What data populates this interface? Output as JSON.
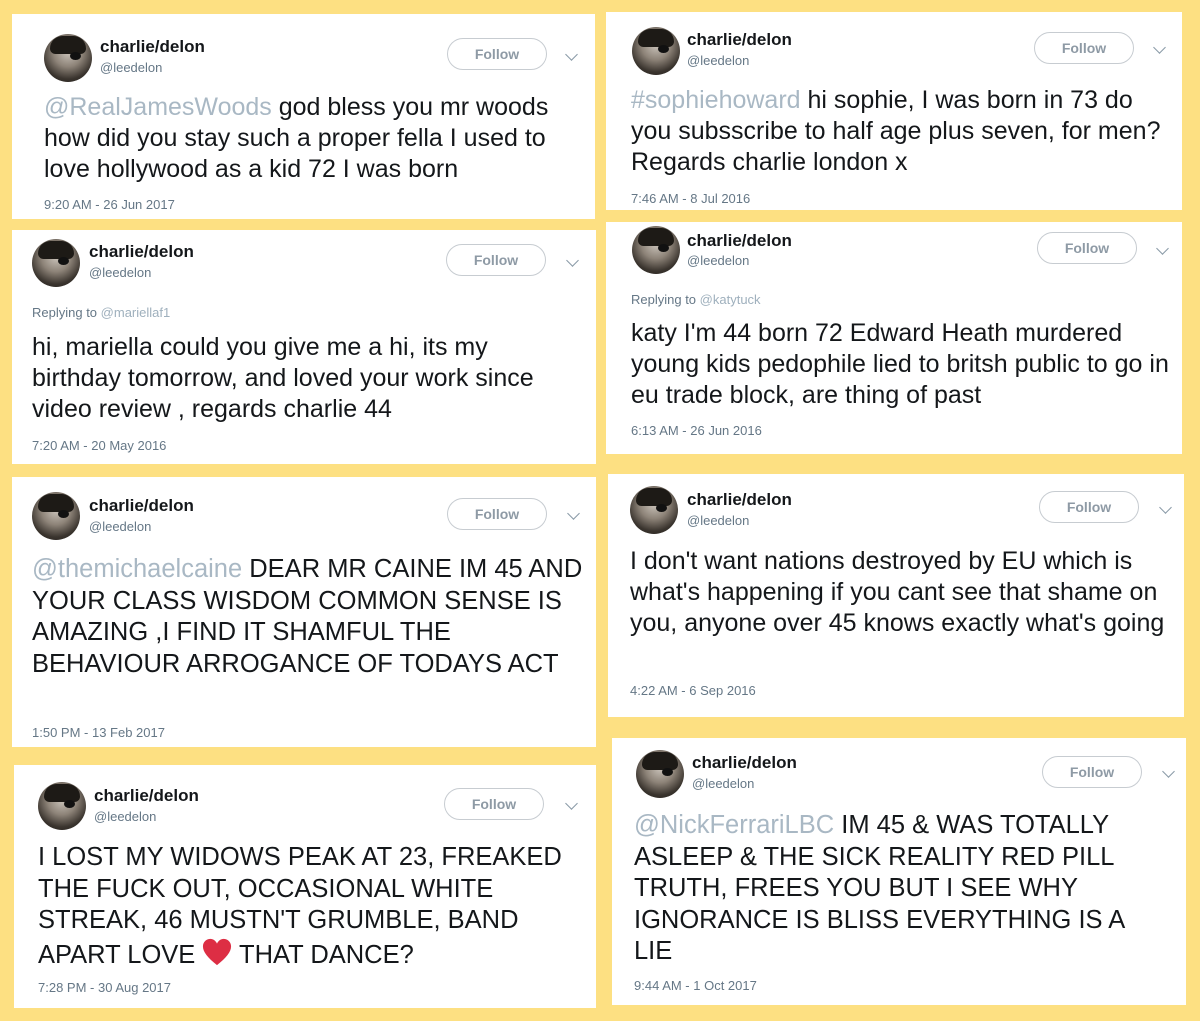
{
  "user": {
    "name": "charlie/delon",
    "handle": "@leedelon",
    "follow_label": "Follow"
  },
  "tweets": [
    {
      "mention": "@RealJamesWoods",
      "text": " god bless you mr woods how did you stay such a proper fella I used to love hollywood as a kid 72 I was born",
      "time": "9:20 AM - 26 Jun 2017"
    },
    {
      "mention": "#sophiehoward",
      "text": "  hi sophie, I was born in 73 do you subsscribe to half age plus seven, for men?  Regards charlie london x",
      "time": "7:46 AM - 8 Jul 2016"
    },
    {
      "reply_prefix": "Replying to",
      "reply_to": "@mariellaf1",
      "text": "hi, mariella could you give me a hi, its my birthday tomorrow, and loved your work since video review , regards charlie 44",
      "time": "7:20 AM - 20 May 2016"
    },
    {
      "reply_prefix": "Replying to",
      "reply_to": "@katytuck",
      "text": "katy I'm 44 born 72 Edward Heath murdered young kids pedophile lied to britsh public to go in eu trade block, are thing of past",
      "time": "6:13 AM - 26 Jun 2016"
    },
    {
      "mention": "@themichaelcaine",
      "text": " DEAR MR CAINE IM 45 AND YOUR CLASS WISDOM COMMON SENSE IS AMAZING ,I FIND IT SHAMFUL THE BEHAVIOUR ARROGANCE OF TODAYS ACT",
      "time": "1:50 PM - 13 Feb 2017"
    },
    {
      "text": "I don't want nations destroyed by EU which is what's happening if you cant see that shame on you, anyone over 45 knows exactly what's going",
      "time": "4:22 AM - 6 Sep 2016"
    },
    {
      "text_before": "I LOST MY WIDOWS PEAK AT 23, FREAKED THE FUCK OUT, OCCASIONAL WHITE STREAK, 46 MUSTN'T GRUMBLE, BAND APART LOVE ",
      "text_after": " THAT DANCE?",
      "emoji": "heart-icon",
      "heart_color": "#dd2e44",
      "time": "7:28 PM - 30 Aug 2017"
    },
    {
      "mention": "@NickFerrariLBC",
      "text": " IM 45 & WAS TOTALLY ASLEEP & THE SICK REALITY RED PILL TRUTH, FREES YOU BUT I SEE WHY IGNORANCE IS BLISS EVERYTHING IS A LIE",
      "time": "9:44 AM - 1 Oct 2017"
    }
  ],
  "colors": {
    "background": "#fde082",
    "card": "#ffffff",
    "mention": "#a9b8c4",
    "text": "#14171a"
  }
}
